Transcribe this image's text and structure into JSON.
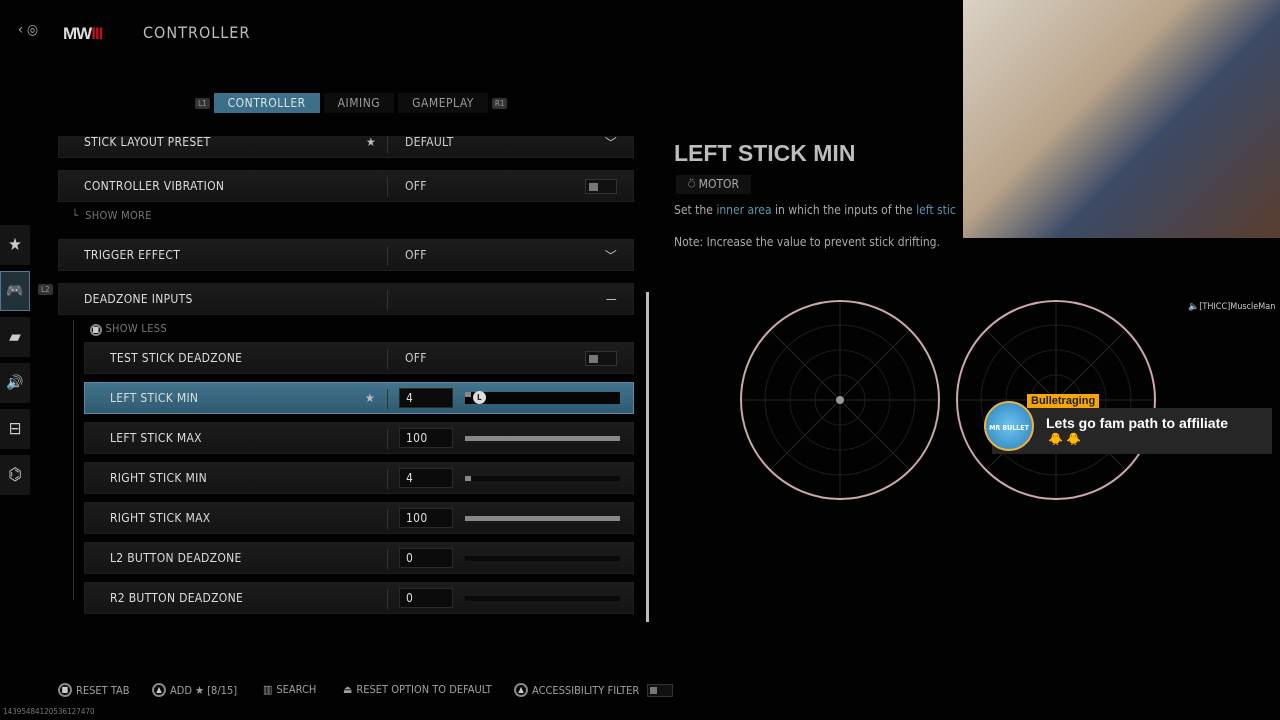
{
  "header": {
    "back_glyph": "‹",
    "logo_text": "MW",
    "logo_mark": "III",
    "title": "CONTROLLER"
  },
  "tabs": {
    "left_bumper": "L1",
    "right_bumper": "R1",
    "items": [
      {
        "label": "CONTROLLER",
        "active": true
      },
      {
        "label": "AIMING"
      },
      {
        "label": "GAMEPLAY"
      }
    ]
  },
  "sidebar": {
    "items": [
      {
        "icon": "star-icon",
        "glyph": "★"
      },
      {
        "icon": "gamepad-icon",
        "glyph": "🎮",
        "active": true
      },
      {
        "icon": "display-icon",
        "glyph": "▰"
      },
      {
        "icon": "speaker-icon",
        "glyph": "🔊"
      },
      {
        "icon": "interface-icon",
        "glyph": "⊟"
      },
      {
        "icon": "network-icon",
        "glyph": "⌬"
      }
    ],
    "l2_hint": "L2"
  },
  "settings": {
    "stick_layout": {
      "label": "STICK LAYOUT PRESET",
      "value": "DEFAULT"
    },
    "vibration": {
      "label": "CONTROLLER VIBRATION",
      "value": "OFF"
    },
    "show_more": "SHOW MORE",
    "trigger": {
      "label": "TRIGGER EFFECT",
      "value": "OFF"
    },
    "deadzone": {
      "label": "DEADZONE INPUTS"
    },
    "show_less": "SHOW LESS",
    "test_stick": {
      "label": "TEST STICK DEADZONE",
      "value": "OFF"
    },
    "sliders": [
      {
        "label": "LEFT STICK MIN",
        "value": "4",
        "percent": 4,
        "selected": true
      },
      {
        "label": "LEFT STICK MAX",
        "value": "100",
        "percent": 100
      },
      {
        "label": "RIGHT STICK MIN",
        "value": "4",
        "percent": 4
      },
      {
        "label": "RIGHT STICK MAX",
        "value": "100",
        "percent": 100
      },
      {
        "label": "L2 BUTTON DEADZONE",
        "value": "0",
        "percent": 0
      },
      {
        "label": "R2 BUTTON DEADZONE",
        "value": "0",
        "percent": 0
      }
    ],
    "knob_letter": "L"
  },
  "detail": {
    "title": "LEFT STICK MIN",
    "tag": "MOTOR",
    "desc_pre": "Set the ",
    "desc_hl1": "inner area",
    "desc_mid": " in which the inputs of the ",
    "desc_hl2": "left stic",
    "note": "Note: Increase the value to prevent stick drifting."
  },
  "overlay": {
    "speaker": "[THICC]MuscleMan",
    "chat_user": "Bulletraging",
    "chat_msg": "Lets go fam path to affiliate",
    "chat_emotes": "🐥 🐥",
    "avatar_text": "MR BULLET"
  },
  "footer": {
    "reset_tab": "RESET TAB",
    "add": "ADD ★ [8/15]",
    "search": "SEARCH",
    "reset_option": "RESET OPTION TO DEFAULT",
    "accessibility": "ACCESSIBILITY FILTER",
    "id": "14395484120536127470"
  },
  "colors": {
    "accent": "#3e6f88",
    "logo_red": "#c0121a",
    "chat_name_bg": "#f4a60c"
  }
}
